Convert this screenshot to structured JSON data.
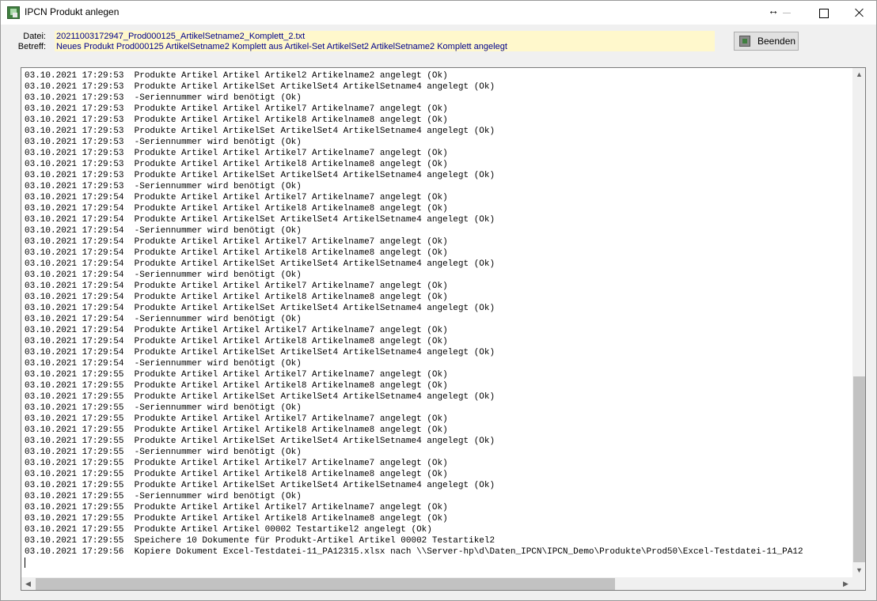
{
  "window": {
    "title": "IPCN Produkt anlegen",
    "icon": "app-icon"
  },
  "info": {
    "datei_label": "Datei:",
    "datei_value": "20211003172947_Prod000125_ArtikelSetname2_Komplett_2.txt",
    "betreff_label": "Betreff:",
    "betreff_value": "Neues Produkt Prod000125 ArtikelSetname2 Komplett aus Artikel-Set ArtikelSet2 ArtikelSetname2 Komplett angelegt",
    "highlight_color": "#fff8cc",
    "value_color": "#00008b"
  },
  "buttons": {
    "beenden_label": "Beenden"
  },
  "log": {
    "lines": [
      "03.10.2021 17:29:53  Produkte Artikel Artikel Artikel2 Artikelname2 angelegt (Ok)",
      "03.10.2021 17:29:53  Produkte Artikel ArtikelSet ArtikelSet4 ArtikelSetname4 angelegt (Ok)",
      "03.10.2021 17:29:53  -Seriennummer wird benötigt (Ok)",
      "03.10.2021 17:29:53  Produkte Artikel Artikel Artikel7 Artikelname7 angelegt (Ok)",
      "03.10.2021 17:29:53  Produkte Artikel Artikel Artikel8 Artikelname8 angelegt (Ok)",
      "03.10.2021 17:29:53  Produkte Artikel ArtikelSet ArtikelSet4 ArtikelSetname4 angelegt (Ok)",
      "03.10.2021 17:29:53  -Seriennummer wird benötigt (Ok)",
      "03.10.2021 17:29:53  Produkte Artikel Artikel Artikel7 Artikelname7 angelegt (Ok)",
      "03.10.2021 17:29:53  Produkte Artikel Artikel Artikel8 Artikelname8 angelegt (Ok)",
      "03.10.2021 17:29:53  Produkte Artikel ArtikelSet ArtikelSet4 ArtikelSetname4 angelegt (Ok)",
      "03.10.2021 17:29:53  -Seriennummer wird benötigt (Ok)",
      "03.10.2021 17:29:54  Produkte Artikel Artikel Artikel7 Artikelname7 angelegt (Ok)",
      "03.10.2021 17:29:54  Produkte Artikel Artikel Artikel8 Artikelname8 angelegt (Ok)",
      "03.10.2021 17:29:54  Produkte Artikel ArtikelSet ArtikelSet4 ArtikelSetname4 angelegt (Ok)",
      "03.10.2021 17:29:54  -Seriennummer wird benötigt (Ok)",
      "03.10.2021 17:29:54  Produkte Artikel Artikel Artikel7 Artikelname7 angelegt (Ok)",
      "03.10.2021 17:29:54  Produkte Artikel Artikel Artikel8 Artikelname8 angelegt (Ok)",
      "03.10.2021 17:29:54  Produkte Artikel ArtikelSet ArtikelSet4 ArtikelSetname4 angelegt (Ok)",
      "03.10.2021 17:29:54  -Seriennummer wird benötigt (Ok)",
      "03.10.2021 17:29:54  Produkte Artikel Artikel Artikel7 Artikelname7 angelegt (Ok)",
      "03.10.2021 17:29:54  Produkte Artikel Artikel Artikel8 Artikelname8 angelegt (Ok)",
      "03.10.2021 17:29:54  Produkte Artikel ArtikelSet ArtikelSet4 ArtikelSetname4 angelegt (Ok)",
      "03.10.2021 17:29:54  -Seriennummer wird benötigt (Ok)",
      "03.10.2021 17:29:54  Produkte Artikel Artikel Artikel7 Artikelname7 angelegt (Ok)",
      "03.10.2021 17:29:54  Produkte Artikel Artikel Artikel8 Artikelname8 angelegt (Ok)",
      "03.10.2021 17:29:54  Produkte Artikel ArtikelSet ArtikelSet4 ArtikelSetname4 angelegt (Ok)",
      "03.10.2021 17:29:54  -Seriennummer wird benötigt (Ok)",
      "03.10.2021 17:29:55  Produkte Artikel Artikel Artikel7 Artikelname7 angelegt (Ok)",
      "03.10.2021 17:29:55  Produkte Artikel Artikel Artikel8 Artikelname8 angelegt (Ok)",
      "03.10.2021 17:29:55  Produkte Artikel ArtikelSet ArtikelSet4 ArtikelSetname4 angelegt (Ok)",
      "03.10.2021 17:29:55  -Seriennummer wird benötigt (Ok)",
      "03.10.2021 17:29:55  Produkte Artikel Artikel Artikel7 Artikelname7 angelegt (Ok)",
      "03.10.2021 17:29:55  Produkte Artikel Artikel Artikel8 Artikelname8 angelegt (Ok)",
      "03.10.2021 17:29:55  Produkte Artikel ArtikelSet ArtikelSet4 ArtikelSetname4 angelegt (Ok)",
      "03.10.2021 17:29:55  -Seriennummer wird benötigt (Ok)",
      "03.10.2021 17:29:55  Produkte Artikel Artikel Artikel7 Artikelname7 angelegt (Ok)",
      "03.10.2021 17:29:55  Produkte Artikel Artikel Artikel8 Artikelname8 angelegt (Ok)",
      "03.10.2021 17:29:55  Produkte Artikel ArtikelSet ArtikelSet4 ArtikelSetname4 angelegt (Ok)",
      "03.10.2021 17:29:55  -Seriennummer wird benötigt (Ok)",
      "03.10.2021 17:29:55  Produkte Artikel Artikel Artikel7 Artikelname7 angelegt (Ok)",
      "03.10.2021 17:29:55  Produkte Artikel Artikel Artikel8 Artikelname8 angelegt (Ok)",
      "03.10.2021 17:29:55  Produkte Artikel Artikel 00002 Testartikel2 angelegt (Ok)",
      "03.10.2021 17:29:55  Speichere 10 Dokumente für Produkt-Artikel Artikel 00002 Testartikel2",
      "03.10.2021 17:29:56  Kopiere Dokument Excel-Testdatei-11_PA12315.xlsx nach \\\\Server-hp\\d\\Daten_IPCN\\IPCN_Demo\\Produkte\\Prod50\\Excel-Testdatei-11_PA12"
    ]
  },
  "scrollbars": {
    "up_icon": "chevron-up-icon",
    "down_icon": "chevron-down-icon",
    "left_icon": "chevron-left-icon",
    "right_icon": "chevron-right-icon"
  }
}
